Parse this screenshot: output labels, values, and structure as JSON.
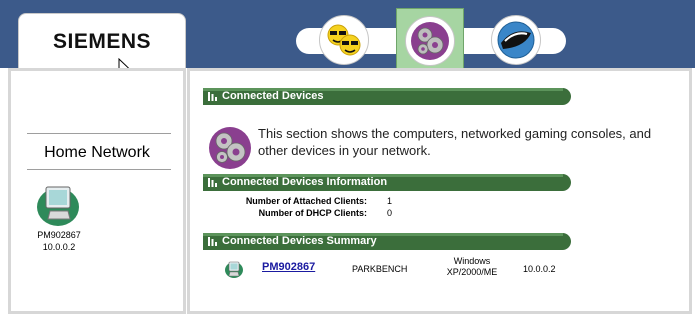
{
  "header": {
    "logo_text": "SIEMENS",
    "tabs": [
      {
        "name": "users-tab",
        "icon": "users-icon",
        "selected": false
      },
      {
        "name": "devices-tab",
        "icon": "gears-icon",
        "selected": true
      },
      {
        "name": "internet-tab",
        "icon": "globe-icon",
        "selected": false
      }
    ]
  },
  "sidebar": {
    "title": "Home Network",
    "device": {
      "name": "PM902867",
      "ip": "10.0.0.2",
      "icon": "computer-icon"
    }
  },
  "main": {
    "sections": [
      {
        "title": "Connected Devices"
      },
      {
        "title": "Connected Devices Information"
      },
      {
        "title": "Connected Devices Summary"
      }
    ],
    "intro_text": "This section shows the computers, networked gaming consoles, and other devices in your network.",
    "info": {
      "attached_label": "Number of Attached Clients:",
      "attached_value": "1",
      "dhcp_label": "Number of DHCP Clients:",
      "dhcp_value": "0"
    },
    "summary": {
      "device_name": "PM902867",
      "host": "PARKBENCH",
      "os_line1": "Windows",
      "os_line2": "XP/2000/ME",
      "ip": "10.0.0.2"
    }
  },
  "colors": {
    "header_bg": "#3c5a8a",
    "section_bar": "#3b6e3b",
    "selected_tab": "#a6d5a2",
    "link": "#1a1aa0"
  }
}
